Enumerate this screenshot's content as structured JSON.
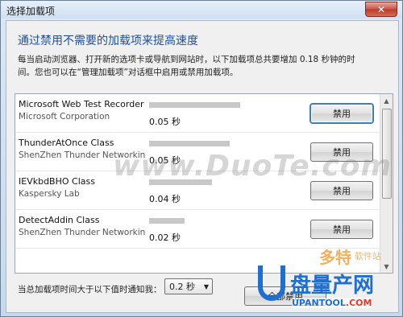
{
  "window": {
    "title": "选择加载项",
    "close_glyph": "✕"
  },
  "heading": "通过禁用不需要的加载项来提高速度",
  "description": "每当启动浏览器、打开新的选项卡或导航到网站时，以下加载项总共要增加 0.18 秒钟的时间。您也可以在“管理加载项”对话框中启用或禁用加载项。",
  "addons": [
    {
      "name": "Microsoft Web Test Recorder",
      "publisher": "Microsoft Corporation",
      "time": "0.05 秒",
      "load_fraction": 0.9,
      "button": "禁用"
    },
    {
      "name": "ThunderAtOnce Class",
      "publisher": "ShenZhen Thunder Networking",
      "time": "0.05 秒",
      "load_fraction": 0.8,
      "button": "禁用"
    },
    {
      "name": "IEVkbdBHO Class",
      "publisher": "Kaspersky Lab",
      "time": "0.04 秒",
      "load_fraction": 0.62,
      "button": "禁用"
    },
    {
      "name": "DetectAddin Class",
      "publisher": "ShenZhen Thunder Networking",
      "time": "0.02 秒",
      "load_fraction": 0.35,
      "button": "禁用"
    }
  ],
  "threshold": {
    "label": "当总加载项时间大于以下值时通知我：",
    "value": "0.2 秒"
  },
  "footer": {
    "disable_all_label": "全部禁用"
  },
  "watermarks": {
    "duote": "www.DuoTe.com",
    "duote_logo": "多特",
    "duote_logo_sub": "软件站",
    "site_name": "盘量产网",
    "site_url_a": "UPANTOOL",
    "site_url_b": ".COM"
  },
  "colors": {
    "heading": "#1f4f9b",
    "bar": "#c8c8c8",
    "focus": "#3c7fb1"
  }
}
